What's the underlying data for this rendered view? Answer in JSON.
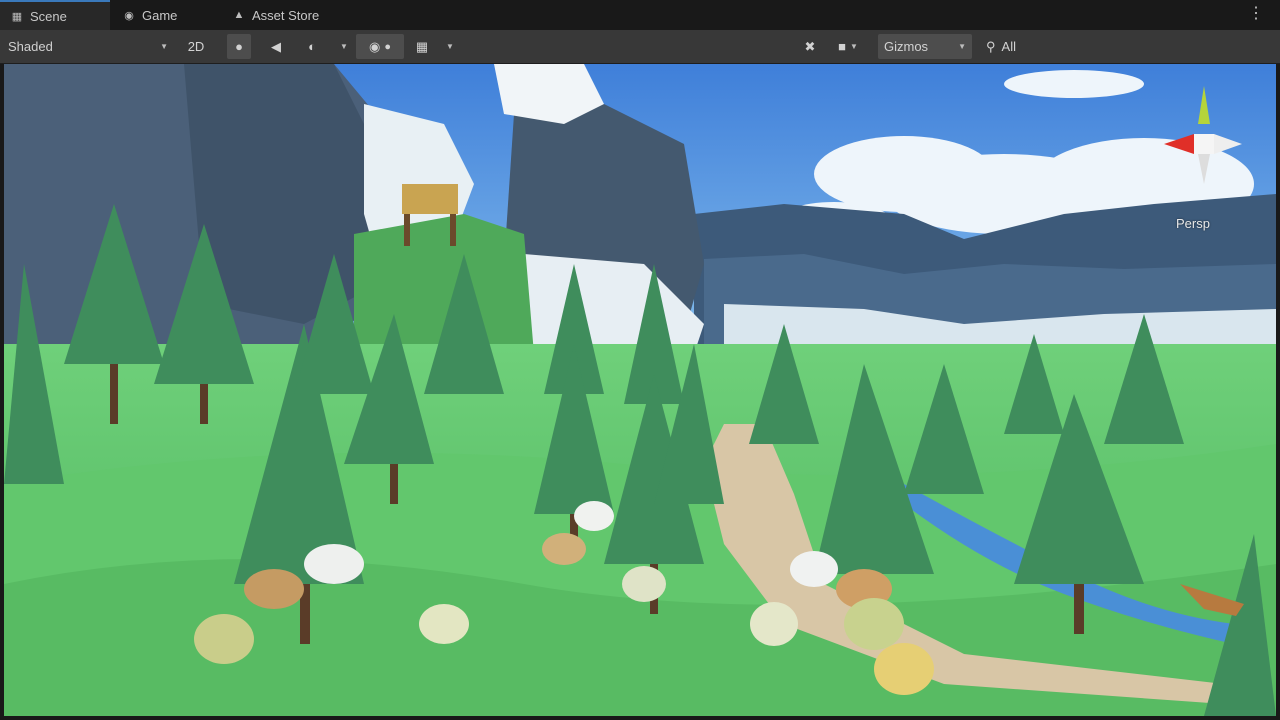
{
  "tabs": [
    {
      "label": "Scene",
      "icon": "grid-icon",
      "active": true
    },
    {
      "label": "Game",
      "icon": "gamepad-icon",
      "active": false
    },
    {
      "label": "Asset Store",
      "icon": "shopping-bag-icon",
      "active": false
    }
  ],
  "toolbar": {
    "shading_mode": "Shaded",
    "mode_2d": "2D",
    "gizmos_label": "Gizmos",
    "search_label": "All"
  },
  "viewport": {
    "projection_label": "Persp"
  },
  "colors": {
    "tab_accent": "#3a79bb",
    "toolbar_bg": "#383838",
    "sky_top": "#3f7fd9",
    "grass": "#5fc56c"
  }
}
